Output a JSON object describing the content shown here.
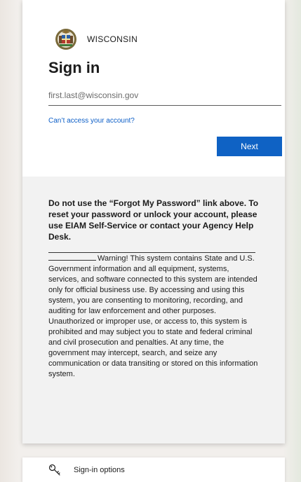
{
  "header": {
    "org_name": "WISCONSIN",
    "seal_icon": "wisconsin-seal-icon"
  },
  "signin": {
    "title": "Sign in",
    "email_placeholder": "first.last@wisconsin.gov",
    "cant_access_link": "Can’t access your account?",
    "next_label": "Next"
  },
  "notice": {
    "heading": "Do not use the “Forgot My Password” link above. To reset your password or unlock your account, please use EIAM Self-Service or contact your Agency Help Desk.",
    "warning": "Warning! This system contains State and U.S. Government information and all equipment, systems, services, and software connected to this system are intended only for official business use. By accessing and using this system, you are consenting to monitoring, recording, and auditing for law enforcement and other purposes. Unauthorized or improper use, or access to, this system is prohibited and may subject you to state and federal criminal and civil prosecution and penalties. At any time, the government may intercept, search, and seize any communication or data transiting or stored on this information system."
  },
  "options": {
    "label": "Sign-in options",
    "icon": "key-icon"
  },
  "colors": {
    "accent": "#0f62c4",
    "link": "#0c5ec7",
    "notice_bg": "#f2f2f2"
  }
}
